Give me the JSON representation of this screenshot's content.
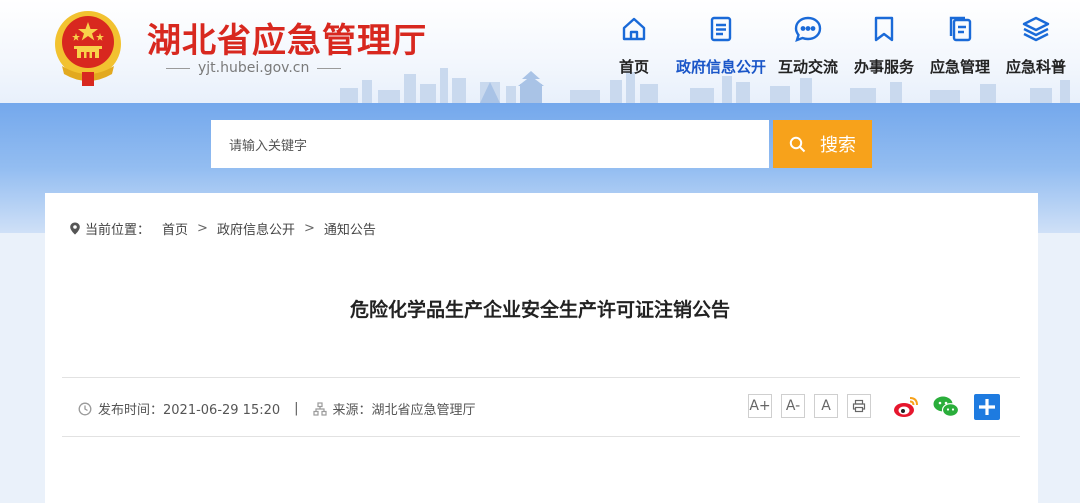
{
  "site": {
    "title": "湖北省应急管理厅",
    "url": "yjt.hubei.gov.cn"
  },
  "nav": [
    {
      "label": "首页",
      "icon": "home-icon"
    },
    {
      "label": "政府信息公开",
      "icon": "document-icon",
      "active": true
    },
    {
      "label": "互动交流",
      "icon": "chat-icon"
    },
    {
      "label": "办事服务",
      "icon": "bookmark-icon"
    },
    {
      "label": "应急管理",
      "icon": "files-icon"
    },
    {
      "label": "应急科普",
      "icon": "layers-icon"
    }
  ],
  "search": {
    "placeholder": "请输入关键字",
    "button_label": "搜索"
  },
  "breadcrumb": {
    "lead": "当前位置：",
    "items": [
      "首页",
      "政府信息公开",
      "通知公告"
    ]
  },
  "article": {
    "title": "危险化学品生产企业安全生产许可证注销公告",
    "published": "发布时间：2021-06-29 15:20",
    "source": "来源：湖北省应急管理厅"
  },
  "tools": {
    "font_large": "A+",
    "font_medium": "A-",
    "font_small": "A"
  },
  "colors": {
    "brand_red": "#d8281f",
    "nav_active": "#1a56c8",
    "search_button": "#f7a21b",
    "band_blue": "#74a8ec",
    "share_plus": "#1e7be0"
  }
}
